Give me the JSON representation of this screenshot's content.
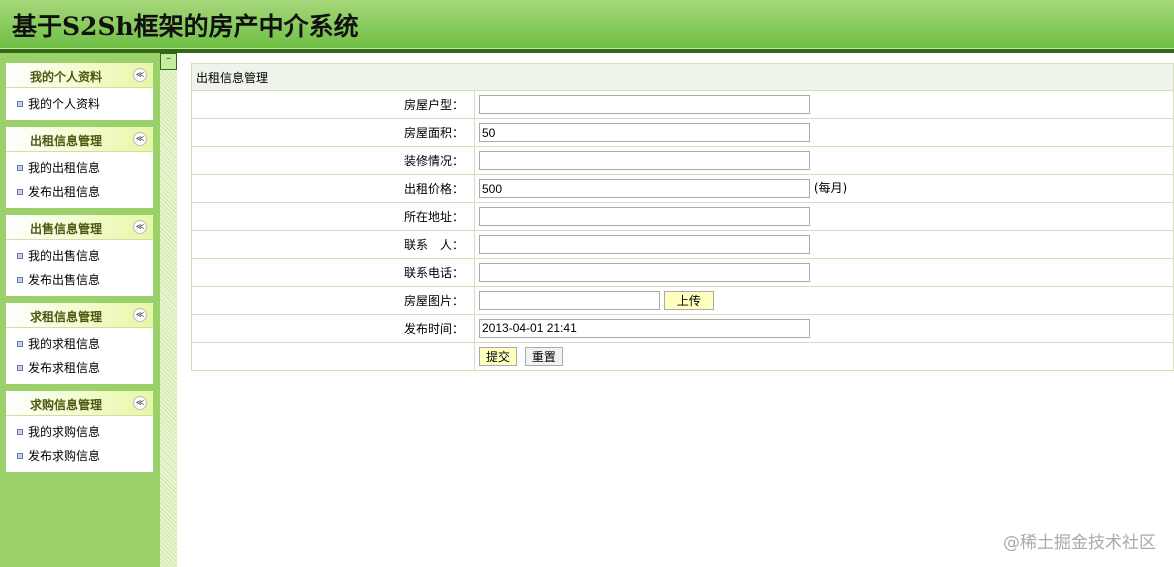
{
  "header": {
    "title": "基于S2Sh框架的房产中介系统"
  },
  "sidebar": {
    "panels": [
      {
        "title": "我的个人资料",
        "items": [
          "我的个人资料"
        ]
      },
      {
        "title": "出租信息管理",
        "items": [
          "我的出租信息",
          "发布出租信息"
        ]
      },
      {
        "title": "出售信息管理",
        "items": [
          "我的出售信息",
          "发布出售信息"
        ]
      },
      {
        "title": "求租信息管理",
        "items": [
          "我的求租信息",
          "发布求租信息"
        ]
      },
      {
        "title": "求购信息管理",
        "items": [
          "我的求购信息",
          "发布求购信息"
        ]
      }
    ],
    "collapse_glyph": "≪",
    "toggle_glyph": "–"
  },
  "form": {
    "title": "出租信息管理",
    "fields": [
      {
        "label": "房屋户型：",
        "value": ""
      },
      {
        "label": "房屋面积：",
        "value": "50"
      },
      {
        "label": "装修情况：",
        "value": ""
      },
      {
        "label": "出租价格：",
        "value": "500",
        "suffix": "(每月)"
      },
      {
        "label": "所在地址：",
        "value": ""
      },
      {
        "label": "联系　人：",
        "value": ""
      },
      {
        "label": "联系电话：",
        "value": ""
      },
      {
        "label": "房屋图片：",
        "value": "",
        "button": "上传"
      },
      {
        "label": "发布时间：",
        "value": "2013-04-01 21:41"
      }
    ],
    "submit": "提交",
    "reset": "重置"
  },
  "watermark": "@稀土掘金技术社区"
}
